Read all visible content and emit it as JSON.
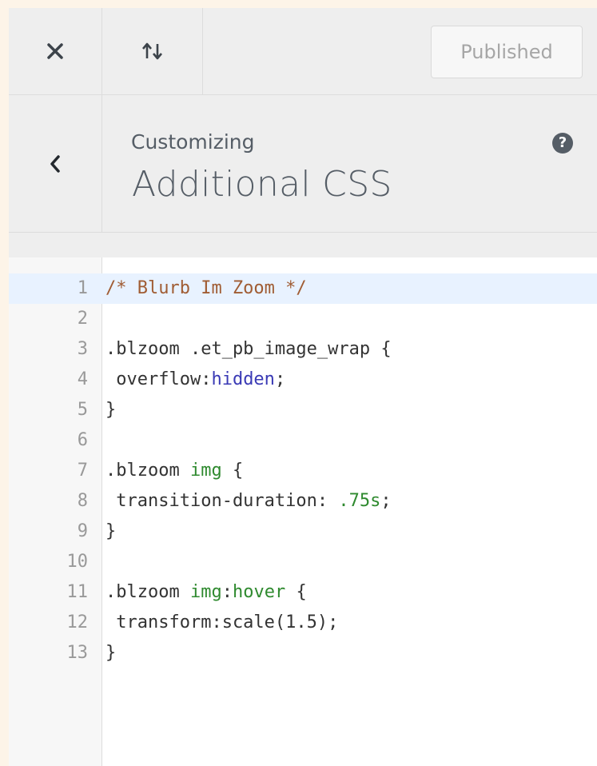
{
  "toolbar": {
    "close_label": "Close",
    "reorder_label": "Reorder",
    "publish_label": "Published"
  },
  "section": {
    "back_label": "Back",
    "breadcrumb": "Customizing",
    "title": "Additional CSS",
    "help_label": "?"
  },
  "editor": {
    "lines": [
      {
        "n": "1",
        "tokens": [
          {
            "t": "/* Blurb Im Zoom */",
            "c": "cm-comment"
          }
        ]
      },
      {
        "n": "2",
        "tokens": []
      },
      {
        "n": "3",
        "tokens": [
          {
            "t": ".blzoom .et_pb_image_wrap {",
            "c": ""
          }
        ]
      },
      {
        "n": "4",
        "tokens": [
          {
            "t": " overflow:",
            "c": ""
          },
          {
            "t": "hidden",
            "c": "cm-atom"
          },
          {
            "t": ";",
            "c": ""
          }
        ]
      },
      {
        "n": "5",
        "tokens": [
          {
            "t": "}",
            "c": ""
          }
        ]
      },
      {
        "n": "6",
        "tokens": []
      },
      {
        "n": "7",
        "tokens": [
          {
            "t": ".blzoom ",
            "c": ""
          },
          {
            "t": "img",
            "c": "cm-tag"
          },
          {
            "t": " {",
            "c": ""
          }
        ]
      },
      {
        "n": "8",
        "tokens": [
          {
            "t": " transition-duration: ",
            "c": ""
          },
          {
            "t": ".75s",
            "c": "cm-num"
          },
          {
            "t": ";",
            "c": ""
          }
        ]
      },
      {
        "n": "9",
        "tokens": [
          {
            "t": "}",
            "c": ""
          }
        ]
      },
      {
        "n": "10",
        "tokens": []
      },
      {
        "n": "11",
        "tokens": [
          {
            "t": ".blzoom ",
            "c": ""
          },
          {
            "t": "img",
            "c": "cm-tag"
          },
          {
            "t": ":",
            "c": ""
          },
          {
            "t": "hover",
            "c": "cm-builtin"
          },
          {
            "t": " {",
            "c": ""
          }
        ]
      },
      {
        "n": "12",
        "tokens": [
          {
            "t": " transform:scale(1.5);",
            "c": ""
          }
        ]
      },
      {
        "n": "13",
        "tokens": [
          {
            "t": "}",
            "c": ""
          }
        ]
      }
    ],
    "active_line": 1
  },
  "colors": {
    "page_bg": "#fdf4e8",
    "panel_bg": "#eeeeee",
    "active_line": "#e8f2ff",
    "comment": "#a05c33",
    "keyword_green": "#2f8a2f",
    "atom_blue": "#3a3ab5"
  }
}
